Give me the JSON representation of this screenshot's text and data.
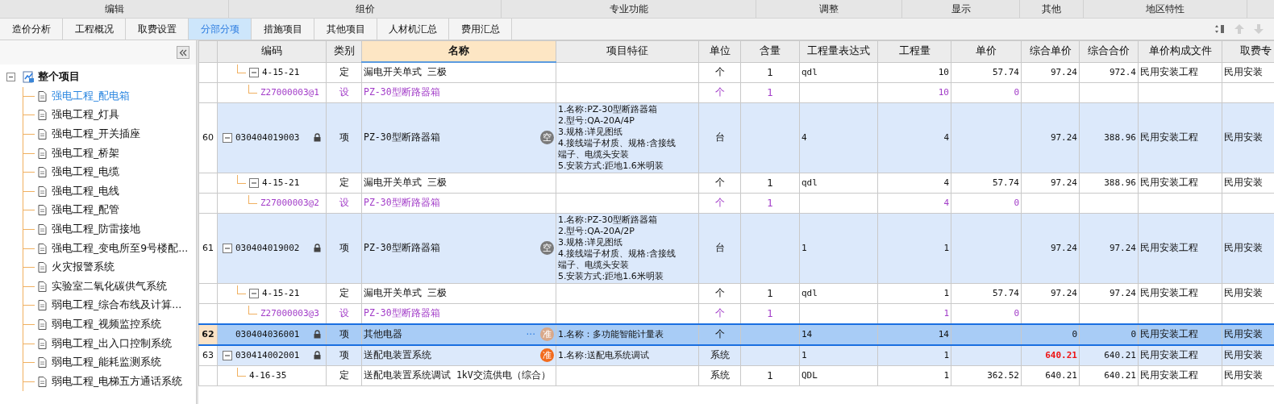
{
  "menu": [
    "编辑",
    "组价",
    "专业功能",
    "调整",
    "显示",
    "其他",
    "地区特性"
  ],
  "tabs": [
    {
      "label": "造价分析",
      "selected": false
    },
    {
      "label": "工程概况",
      "selected": false
    },
    {
      "label": "取费设置",
      "selected": false
    },
    {
      "label": "分部分项",
      "selected": true
    },
    {
      "label": "措施项目",
      "selected": false
    },
    {
      "label": "其他项目",
      "selected": false
    },
    {
      "label": "人材机汇总",
      "selected": false
    },
    {
      "label": "费用汇总",
      "selected": false
    }
  ],
  "sidebar": {
    "root": {
      "label": "整个项目",
      "expanded": true,
      "children": [
        {
          "label": "强电工程_配电箱",
          "selected": true
        },
        {
          "label": "强电工程_灯具",
          "selected": false
        },
        {
          "label": "强电工程_开关插座",
          "selected": false
        },
        {
          "label": "强电工程_桥架",
          "selected": false
        },
        {
          "label": "强电工程_电缆",
          "selected": false
        },
        {
          "label": "强电工程_电线",
          "selected": false
        },
        {
          "label": "强电工程_配管",
          "selected": false
        },
        {
          "label": "强电工程_防雷接地",
          "selected": false
        },
        {
          "label": "强电工程_变电所至9号楼配...",
          "selected": false
        },
        {
          "label": "火灾报警系统",
          "selected": false
        },
        {
          "label": "实验室二氧化碳供气系统",
          "selected": false
        },
        {
          "label": "弱电工程_综合布线及计算...",
          "selected": false
        },
        {
          "label": "弱电工程_视频监控系统",
          "selected": false
        },
        {
          "label": "弱电工程_出入口控制系统",
          "selected": false
        },
        {
          "label": "弱电工程_能耗监测系统",
          "selected": false
        },
        {
          "label": "弱电工程_电梯五方通话系统",
          "selected": false
        }
      ]
    }
  },
  "table": {
    "columns": [
      {
        "selected": false
      },
      {
        "label": "编码",
        "selected": false
      },
      {
        "label": "类别",
        "selected": false
      },
      {
        "label": "名称",
        "selected": true
      },
      {
        "label": "项目特征",
        "selected": false
      },
      {
        "label": "单位",
        "selected": false
      },
      {
        "label": "含量",
        "selected": false
      },
      {
        "label": "工程量表达式",
        "selected": false
      },
      {
        "label": "工程量",
        "selected": false
      },
      {
        "label": "单价",
        "selected": false
      },
      {
        "label": "综合单价",
        "selected": false
      },
      {
        "label": "综合合价",
        "selected": false
      },
      {
        "label": "单价构成文件",
        "selected": false
      },
      {
        "label": "取费专",
        "selected": false
      }
    ],
    "rows": [
      {
        "kind": "de",
        "code": "4-15-21",
        "type": "定",
        "name": "漏电开关单式 三极",
        "unit": "个",
        "content": "1",
        "expr": "qdl",
        "qty": "10",
        "price": "57.74",
        "unit_total": "97.24",
        "unit_total_flagged": false,
        "total": "972.4",
        "file": "民用安装工程",
        "fee": "民用安装",
        "selected": false,
        "expanded": true,
        "children": [
          {
            "kind": "sb",
            "code": "Z27000003@1",
            "type": "设",
            "name": "PZ-30型断路器箱",
            "unit": "个",
            "content": "1",
            "qty": "10",
            "price": "0",
            "selected": false
          }
        ]
      },
      {
        "kind": "qd",
        "num": "60",
        "code": "030404019003",
        "type": "项",
        "name": "PZ-30型断路器箱",
        "badge": {
          "text": "空",
          "color": "#7a7a7a"
        },
        "features": [
          "1.名称:PZ-30型断路器箱",
          "2.型号:QA-20A/4P",
          "3.规格:详见图纸",
          "4.接线端子材质、规格:含接线",
          "端子、电缆头安装",
          "5.安装方式:距地1.6米明装"
        ],
        "unit": "台",
        "expr": "4",
        "qty": "4",
        "unit_total": "97.24",
        "unit_total_flagged": false,
        "total": "388.96",
        "file": "民用安装工程",
        "fee": "民用安装",
        "selected": false,
        "expanded": true,
        "children": [
          {
            "kind": "de",
            "code": "4-15-21",
            "type": "定",
            "name": "漏电开关单式 三极",
            "unit": "个",
            "content": "1",
            "expr": "qdl",
            "qty": "4",
            "price": "57.74",
            "unit_total": "97.24",
            "unit_total_flagged": false,
            "total": "388.96",
            "file": "民用安装工程",
            "fee": "民用安装",
            "selected": false,
            "expanded": true,
            "children": [
              {
                "kind": "sb",
                "code": "Z27000003@2",
                "type": "设",
                "name": "PZ-30型断路器箱",
                "unit": "个",
                "content": "1",
                "qty": "4",
                "price": "0",
                "selected": false
              }
            ]
          }
        ]
      },
      {
        "kind": "qd",
        "num": "61",
        "code": "030404019002",
        "type": "项",
        "name": "PZ-30型断路器箱",
        "badge": {
          "text": "空",
          "color": "#7a7a7a"
        },
        "features": [
          "1.名称:PZ-30型断路器箱",
          "2.型号:QA-20A/2P",
          "3.规格:详见图纸",
          "4.接线端子材质、规格:含接线",
          "端子、电缆头安装",
          "5.安装方式:距地1.6米明装"
        ],
        "unit": "台",
        "expr": "1",
        "qty": "1",
        "unit_total": "97.24",
        "unit_total_flagged": false,
        "total": "97.24",
        "file": "民用安装工程",
        "fee": "民用安装",
        "selected": false,
        "expanded": true,
        "children": [
          {
            "kind": "de",
            "code": "4-15-21",
            "type": "定",
            "name": "漏电开关单式 三极",
            "unit": "个",
            "content": "1",
            "expr": "qdl",
            "qty": "1",
            "price": "57.74",
            "unit_total": "97.24",
            "unit_total_flagged": false,
            "total": "97.24",
            "file": "民用安装工程",
            "fee": "民用安装",
            "selected": false,
            "expanded": true,
            "children": [
              {
                "kind": "sb",
                "code": "Z27000003@3",
                "type": "设",
                "name": "PZ-30型断路器箱",
                "unit": "个",
                "content": "1",
                "qty": "1",
                "price": "0",
                "selected": false
              }
            ]
          }
        ]
      },
      {
        "kind": "qd",
        "num": "62",
        "code": "030404036001",
        "type": "项",
        "name": "其他电器",
        "more": "···",
        "badge": {
          "text": "准",
          "color": "#d9a88a"
        },
        "features": [
          "1.名称：多功能智能计量表"
        ],
        "unit": "个",
        "expr": "14",
        "qty": "14",
        "unit_total": "0",
        "unit_total_flagged": false,
        "total": "0",
        "file": "民用安装工程",
        "fee": "民用安装",
        "selected": true
      },
      {
        "kind": "qd",
        "num": "63",
        "code": "030414002001",
        "type": "项",
        "name": "送配电装置系统",
        "badge": {
          "text": "准",
          "color": "#f26b1d"
        },
        "features": [
          "1.名称:送配电系统调试"
        ],
        "unit": "系统",
        "expr": "1",
        "qty": "1",
        "unit_total": "640.21",
        "unit_total_flagged": true,
        "total": "640.21",
        "file": "民用安装工程",
        "fee": "民用安装",
        "selected": false,
        "expanded": true,
        "children": [
          {
            "kind": "de",
            "code": "4-16-35",
            "type": "定",
            "name": "送配电装置系统调试 1kV交流供电（综合）",
            "unit": "系统",
            "content": "1",
            "expr": "QDL",
            "qty": "1",
            "price": "362.52",
            "unit_total": "640.21",
            "unit_total_flagged": false,
            "total": "640.21",
            "file": "民用安装工程",
            "fee": "民用安装",
            "selected": false
          }
        ]
      }
    ]
  }
}
